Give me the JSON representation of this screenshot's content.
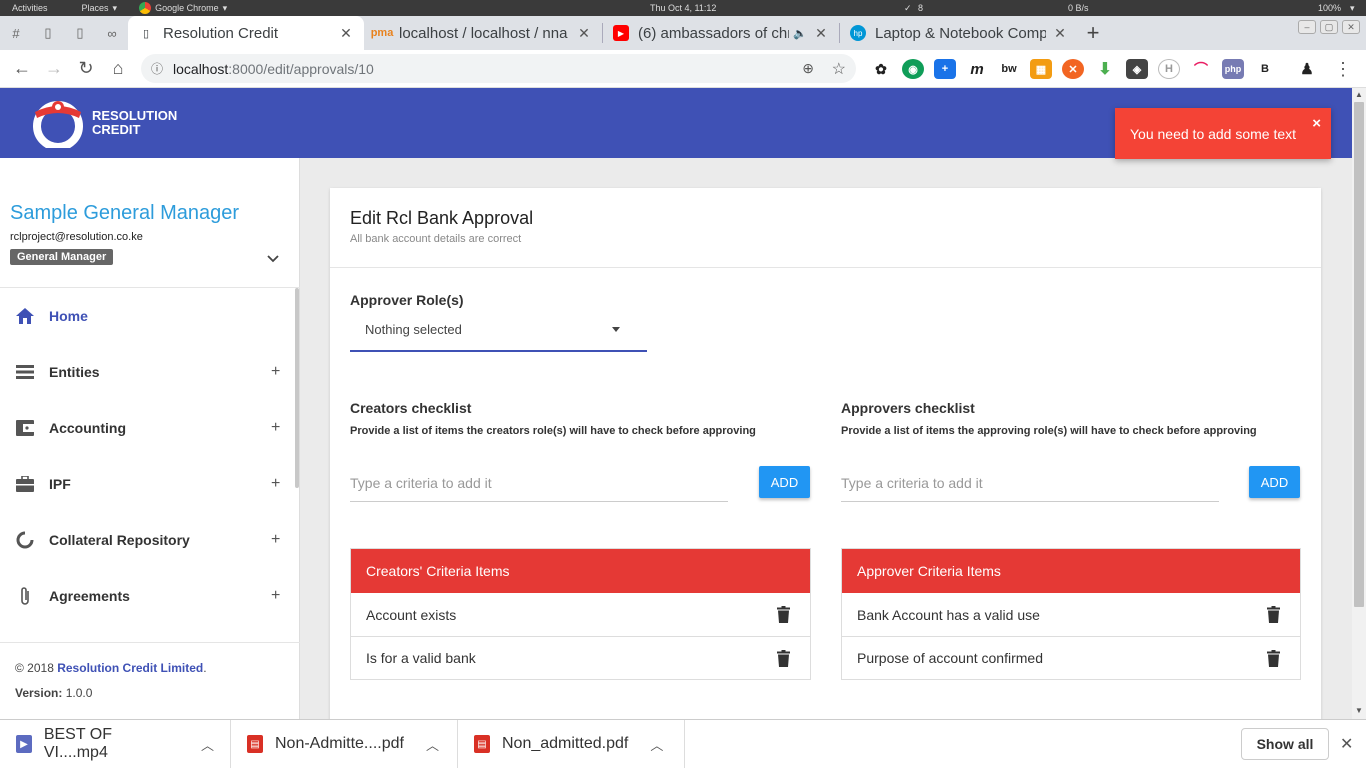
{
  "system_bar": {
    "activities": "Activities",
    "places": "Places",
    "chrome": "Google Chrome",
    "clock": "Thu Oct  4, 11:12",
    "notif_count": "8",
    "net_rate": "0 B/s",
    "battery": "100%"
  },
  "browser": {
    "tabs": [
      {
        "title": "Resolution Credit",
        "active": true
      },
      {
        "title": "localhost / localhost / nna"
      },
      {
        "title": "(6) ambassadors of chr"
      },
      {
        "title": "Laptop & Notebook Comp"
      }
    ],
    "url_host": "localhost",
    "url_path": ":8000/edit/approvals/10"
  },
  "header": {
    "brand_line1": "RESOLUTION",
    "brand_line2": "CREDIT"
  },
  "toast": {
    "message": "You need to add some text",
    "close": "×"
  },
  "sidebar": {
    "user_name": "Sample General Manager",
    "user_email": "rclproject@resolution.co.ke",
    "role": "General Manager",
    "items": [
      {
        "label": "Home",
        "icon": "home-icon",
        "expandable": false
      },
      {
        "label": "Entities",
        "icon": "list-icon",
        "expandable": true
      },
      {
        "label": "Accounting",
        "icon": "wallet-icon",
        "expandable": true
      },
      {
        "label": "IPF",
        "icon": "briefcase-icon",
        "expandable": true
      },
      {
        "label": "Collateral Repository",
        "icon": "circle-notch-icon",
        "expandable": true
      },
      {
        "label": "Agreements",
        "icon": "paperclip-icon",
        "expandable": true
      }
    ],
    "footer": {
      "copyright_prefix": "© 2018",
      "company": "Resolution Credit Limited",
      "version_label": "Version:",
      "version": "1.0.0"
    }
  },
  "form": {
    "title": "Edit Rcl Bank Approval",
    "subtitle": "All bank account details are correct",
    "approver_roles_label": "Approver Role(s)",
    "approver_roles_value": "Nothing selected",
    "creators": {
      "title": "Creators checklist",
      "description": "Provide a list of items the creators role(s) will have to check before approving",
      "input_placeholder": "Type a criteria to add it",
      "add_label": "ADD",
      "list_title": "Creators' Criteria Items",
      "items": [
        "Account exists",
        "Is for a valid bank"
      ]
    },
    "approvers": {
      "title": "Approvers checklist",
      "description": "Provide a list of items the approving role(s) will have to check before approving",
      "input_placeholder": "Type a criteria to add it",
      "add_label": "ADD",
      "list_title": "Approver Criteria Items",
      "items": [
        "Bank Account has a valid use",
        "Purpose of account confirmed"
      ]
    }
  },
  "downloads": {
    "items": [
      {
        "name": "BEST OF VI....mp4",
        "icon": "video-file-icon"
      },
      {
        "name": "Non-Admitte....pdf",
        "icon": "pdf-file-icon"
      },
      {
        "name": "Non_admitted.pdf",
        "icon": "pdf-file-icon"
      }
    ],
    "show_all": "Show all"
  },
  "colors": {
    "primary": "#3f51b5",
    "danger": "#e53935",
    "toast": "#f44336",
    "button": "#2196f3",
    "user_name": "#2d9cdb"
  }
}
